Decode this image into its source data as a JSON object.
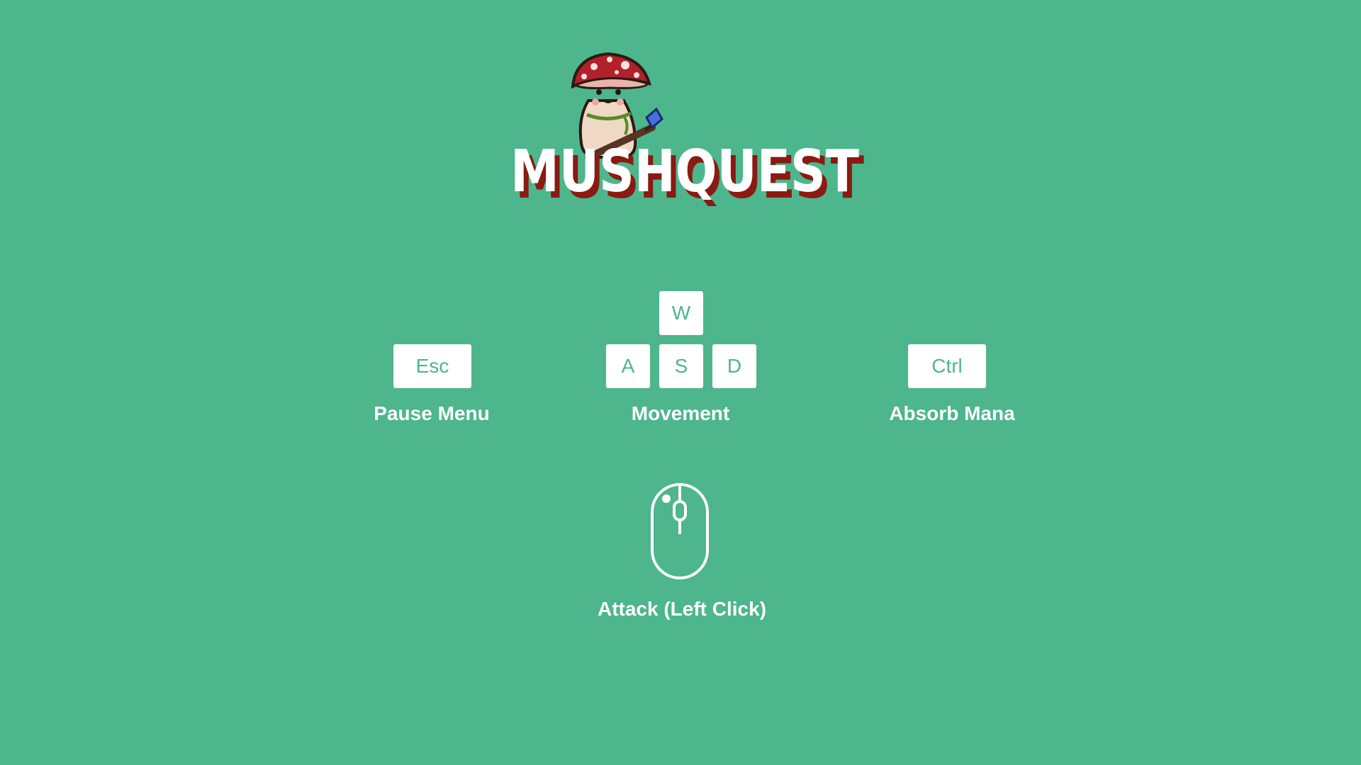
{
  "game": {
    "title": "MUSHQUEST"
  },
  "controls": {
    "pause": {
      "key": "Esc",
      "label": "Pause Menu"
    },
    "movement": {
      "keys": {
        "up": "W",
        "left": "A",
        "down": "S",
        "right": "D"
      },
      "label": "Movement"
    },
    "absorb": {
      "key": "Ctrl",
      "label": "Absorb Mana"
    },
    "attack": {
      "label": "Attack (Left Click)"
    }
  },
  "icons": {
    "mouse": "mouse-icon",
    "mascot": "mushroom-mascot-icon"
  },
  "colors": {
    "background": "#4db68c",
    "key_face": "#ffffff",
    "key_text": "#4db68c",
    "label_text": "#ffffff",
    "title_fill": "#ffffff",
    "title_shadow": "#8a1a12",
    "mushroom_cap": "#b0212a"
  }
}
